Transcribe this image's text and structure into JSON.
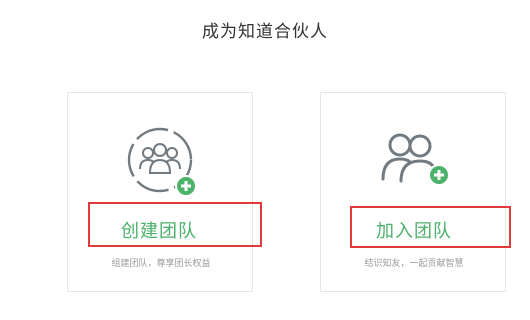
{
  "page": {
    "title": "成为知道合伙人"
  },
  "cards": [
    {
      "icon": "create-team-icon",
      "title": "创建团队",
      "description": "组建团队，尊享团长权益"
    },
    {
      "icon": "join-team-icon",
      "title": "加入团队",
      "description": "结识知友，一起贡献智慧"
    }
  ],
  "colors": {
    "accent_green": "#4cb26a",
    "icon_gray": "#707a80",
    "highlight_red": "#e23a3a",
    "card_border": "#e6e6e6"
  }
}
